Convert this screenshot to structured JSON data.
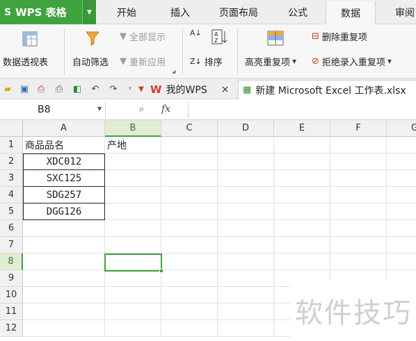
{
  "app": {
    "name": "WPS 表格",
    "logo": "S"
  },
  "menu_tabs": [
    "开始",
    "插入",
    "页面布局",
    "公式",
    "数据",
    "审阅"
  ],
  "active_tab": "数据",
  "ribbon": {
    "pivot": "数据透视表",
    "autofilter": "自动筛选",
    "show_all": "全部显示",
    "reapply": "重新应用",
    "sort": "排序",
    "highlight_dup": "高亮重复项",
    "remove_dup": "删除重复项",
    "reject_dup": "拒绝录入重复项"
  },
  "doc_tabs": {
    "home_tab": "我的WPS",
    "file_tab": "新建 Microsoft Excel 工作表.xlsx",
    "close_glyph": "×"
  },
  "formula_bar": {
    "name_box": "B8",
    "fx": "fx",
    "value": ""
  },
  "sheet": {
    "columns": [
      "A",
      "B",
      "C",
      "D",
      "E",
      "F",
      "G"
    ],
    "rows": [
      "1",
      "2",
      "3",
      "4",
      "5",
      "6",
      "7",
      "8",
      "9",
      "10",
      "11",
      "12"
    ],
    "selected_cell": "B8",
    "cells": {
      "A1": "商品品名",
      "B1": "产地",
      "A2": "XDC012",
      "A3": "SXC125",
      "A4": "SDG257",
      "A5": "DGG126"
    }
  },
  "watermark": "软件技巧",
  "colors": {
    "accent": "#3fa33f",
    "header_bg": "#f1f1f1"
  }
}
